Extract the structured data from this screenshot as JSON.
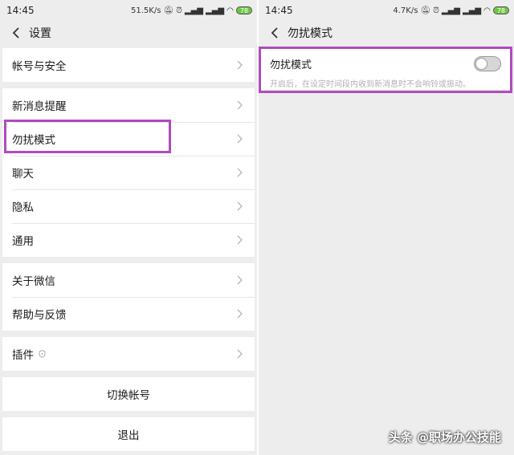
{
  "left": {
    "status": {
      "time": "14:45",
      "speed": "51.5K/s",
      "battery": "78"
    },
    "title": "设置",
    "groups": [
      [
        {
          "label": "帐号与安全"
        }
      ],
      [
        {
          "label": "新消息提醒"
        },
        {
          "label": "勿扰模式"
        },
        {
          "label": "聊天"
        },
        {
          "label": "隐私"
        },
        {
          "label": "通用"
        }
      ],
      [
        {
          "label": "关于微信"
        },
        {
          "label": "帮助与反馈"
        }
      ],
      [
        {
          "label": "插件"
        }
      ]
    ],
    "switch_account": "切换帐号",
    "logout": "退出"
  },
  "right": {
    "status": {
      "time": "14:45",
      "speed": "4.7K/s",
      "battery": "78"
    },
    "title": "勿扰模式",
    "dnd": {
      "label": "勿扰模式",
      "description": "开启后，在设定时间段内收到新消息时不会响铃或振动。",
      "enabled": false
    }
  },
  "watermark": "头条 @职场办公技能",
  "colors": {
    "highlight": "#b04ac0",
    "background": "#ededed",
    "battery": "#6cc644"
  },
  "icons": [
    "back-chevron-icon",
    "chevron-right-icon",
    "shield-icon",
    "mute-icon",
    "alarm-icon",
    "signal-icon",
    "wifi-icon",
    "battery-icon"
  ]
}
